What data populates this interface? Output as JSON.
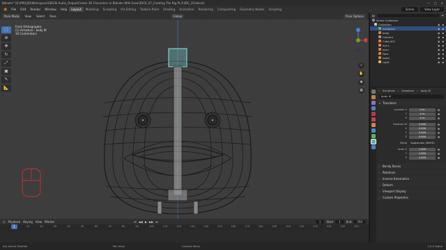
{
  "titlebar": {
    "title": "Blender* [D:\\PROJ3D\\Workspace\\GBS-Bi-Audio_Output\\Create 3D Characters in Blender With Ease\\3DCE_07_Creating The Rig Pt.2\\3DC_20.blend]"
  },
  "menu": {
    "items": [
      "File",
      "Edit",
      "Render",
      "Window",
      "Help"
    ],
    "workspaces": [
      "Layout",
      "Modeling",
      "Sculpting",
      "UV Editing",
      "Texture Paint",
      "Shading",
      "Animation",
      "Rendering",
      "Compositing",
      "Geometry Nodes",
      "Scripting"
    ],
    "active_workspace": "Layout",
    "scene": "Scene",
    "view_layer": "View Layer"
  },
  "viewport_header": {
    "mode": "Pose Mode",
    "menus": [
      "View",
      "Select",
      "Pose"
    ],
    "orientation": "Global",
    "options": "Pose Options"
  },
  "overlay": {
    "line1": "Front Orthographic",
    "line2": "(1) Armature : body IK",
    "line3": "10 Centimeters"
  },
  "toolbar": {
    "icons": [
      "select-box-icon",
      "cursor-icon",
      "move-icon",
      "rotate-icon",
      "scale-icon",
      "transform-icon",
      "annotate-icon",
      "measure-icon"
    ]
  },
  "outliner": {
    "header": "Scene Collection",
    "rows": [
      {
        "label": "Collection",
        "indent": 0,
        "color": "#cccccc"
      },
      {
        "label": "Armature",
        "indent": 1,
        "color": "#5ab55a",
        "selected": true
      },
      {
        "label": "body",
        "indent": 1,
        "color": "#e08040"
      },
      {
        "label": "Camera",
        "indent": 1,
        "color": "#999999"
      },
      {
        "label": "Cube.001",
        "indent": 1,
        "color": "#e08040"
      },
      {
        "label": "eye L",
        "indent": 1,
        "color": "#e08040"
      },
      {
        "label": "eye.r",
        "indent": 1,
        "color": "#e08040"
      },
      {
        "label": "Face",
        "indent": 1,
        "color": "#e08040"
      },
      {
        "label": "teeth",
        "indent": 1,
        "color": "#e08040"
      },
      {
        "label": "Light",
        "indent": 1,
        "color": "#d0c040"
      }
    ]
  },
  "properties": {
    "breadcrumb": [
      "Armature",
      "Armature",
      "body IK"
    ],
    "bone_name": "body IK",
    "transform": {
      "title": "Transform",
      "location": {
        "label": "Location X",
        "x": "0 m",
        "y": "0 m",
        "z": "0 m"
      },
      "rotation": {
        "label": "Rotation W",
        "w": "1.000",
        "x": "0.000",
        "y": "0.000",
        "z": "0.000"
      },
      "mode": {
        "label": "Mode",
        "value": "Quaternion (WXYZ)"
      },
      "scale": {
        "label": "Scale X",
        "x": "1.000",
        "y": "1.000",
        "z": "1.000"
      }
    },
    "panels": [
      "Bendy Bones",
      "Relations",
      "Inverse Kinematics",
      "Deform",
      "Viewport Display",
      "Custom Properties"
    ]
  },
  "timeline": {
    "menus": [
      "Playback",
      "Keying",
      "View",
      "Marker"
    ],
    "current_frame": "1",
    "start_label": "Start",
    "start": "1",
    "end_label": "End",
    "end": "250",
    "ticks": [
      "1",
      "10",
      "20",
      "30",
      "40",
      "50",
      "60",
      "70",
      "80",
      "90",
      "100",
      "110",
      "120",
      "130",
      "140",
      "150",
      "160",
      "170",
      "180",
      "190",
      "200",
      "210",
      "220",
      "230",
      "240",
      "250"
    ]
  },
  "statusbar": {
    "item1": "Set Active Modifier",
    "item2": "Pan View",
    "item3": "Context Menu",
    "version": "3.0.0 Alpha"
  },
  "colors": {
    "accent": "#4772b3",
    "bone": "#7ad0d0",
    "ik_control": "#d03030",
    "axis_green": "#6aa020"
  }
}
